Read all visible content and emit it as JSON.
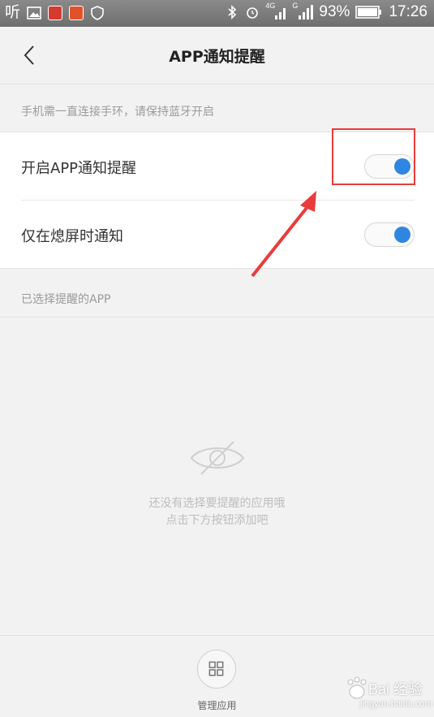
{
  "status_bar": {
    "left_text": "听",
    "signal_label_1": "4G",
    "signal_label_2": "G",
    "battery": "93%",
    "time": "17:26"
  },
  "header": {
    "title": "APP通知提醒"
  },
  "hint": "手机需一直连接手环，请保持蓝牙开启",
  "settings": [
    {
      "label": "开启APP通知提醒",
      "enabled": true
    },
    {
      "label": "仅在熄屏时通知",
      "enabled": true
    }
  ],
  "selected_section_title": "已选择提醒的APP",
  "empty_state": {
    "line1": "还没有选择要提醒的应用哦",
    "line2": "点击下方按钮添加吧"
  },
  "bottom": {
    "manage_label": "管理应用"
  },
  "watermark": {
    "brand": "Bai 经验",
    "site": "jingyan.baidu.com"
  },
  "colors": {
    "toggle_on": "#2f86e0",
    "highlight": "#ea3b3b",
    "background": "#f2f2f2"
  }
}
